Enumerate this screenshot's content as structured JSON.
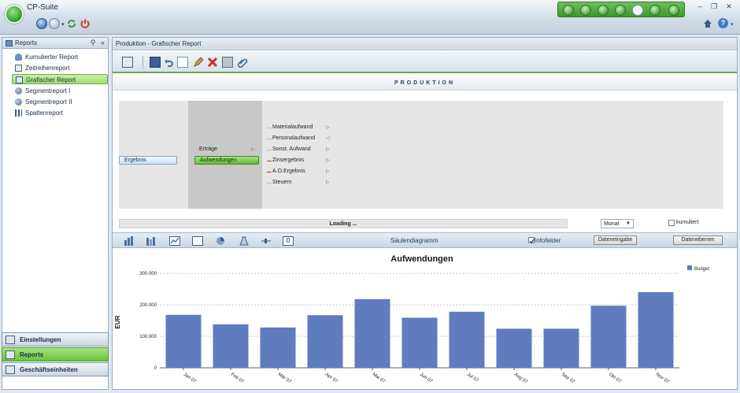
{
  "app": {
    "title": "CP-Suite"
  },
  "left_panel": {
    "header": "Reports",
    "items": [
      {
        "label": "Kumulierter Report",
        "icon": "stacked-person-icon"
      },
      {
        "label": "Zeitreihenreport",
        "icon": "calendar-icon"
      },
      {
        "label": "Grafischer Report",
        "icon": "chart-icon",
        "selected": true
      },
      {
        "label": "Segmentreport I",
        "icon": "globe-icon"
      },
      {
        "label": "Segmentreport II",
        "icon": "globe-icon"
      },
      {
        "label": "Spaltenreport",
        "icon": "columns-icon"
      }
    ],
    "sections": [
      {
        "label": "Einstellungen",
        "active": false
      },
      {
        "label": "Reports",
        "active": true
      },
      {
        "label": "Geschäftseinheiten",
        "active": false
      }
    ]
  },
  "main": {
    "breadcrumb": "Produktion - Grafischer Report",
    "band_title": "PRODUKTION",
    "tree": {
      "root": "Ergebnis",
      "level1": [
        {
          "label": "Erträge",
          "selected": false
        },
        {
          "label": "Aufwendungen",
          "selected": true
        }
      ],
      "level2": [
        {
          "label": "Materialaufwand",
          "marker": ""
        },
        {
          "label": "Personalaufwand",
          "marker": ""
        },
        {
          "label": "Sonst. Aufwand",
          "marker": ""
        },
        {
          "label": "Zinsergebnis",
          "marker": "minus"
        },
        {
          "label": "A.O.Ergebnis",
          "marker": "minus"
        },
        {
          "label": "Steuern",
          "marker": ""
        }
      ]
    },
    "status_text": "Loading ...",
    "period_select": "Monat",
    "kumuliert_label": "kumuliert",
    "chart_type_label": "Säulendiagramm",
    "infofelder_label": "Infofelder",
    "infofelder_checked": true,
    "datasource_button": "Dateneingabe",
    "datalevels_button": "Datenebenen"
  },
  "chart_data": {
    "type": "bar",
    "title": "Aufwendungen",
    "ylabel": "EUR",
    "xlabel": "",
    "categories": [
      "Jan 07",
      "Feb 07",
      "Mär 07",
      "Apr 07",
      "Mai 07",
      "Jun 07",
      "Jul 07",
      "Aug 07",
      "Sep 07",
      "Okt 07",
      "Nov 07"
    ],
    "series": [
      {
        "name": "Budget",
        "values": [
          168000,
          138000,
          128000,
          167000,
          218000,
          159000,
          178000,
          124000,
          124000,
          197000,
          240000
        ]
      }
    ],
    "ylim": [
      0,
      300000
    ],
    "yticks": [
      "0",
      "100.000",
      "200.000",
      "300.000"
    ],
    "grid": true,
    "legend": "top-right",
    "bar_color": "#5f7cbf"
  }
}
